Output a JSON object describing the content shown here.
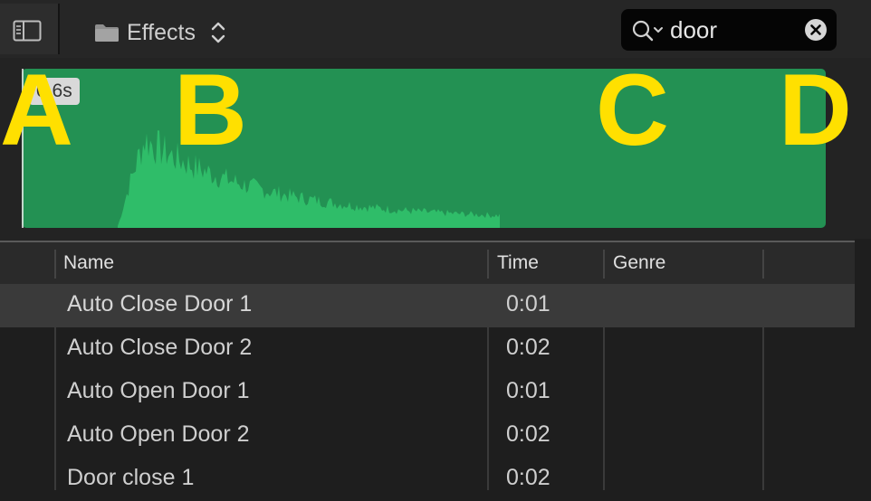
{
  "toolbar": {
    "library_title": "Effects",
    "search_value": "door",
    "icons": {
      "sidebar": "sidebar-toggle-icon",
      "folder": "folder-icon",
      "chevron": "up-down-chevron-icon",
      "search": "search-icon",
      "clear": "clear-icon"
    }
  },
  "preview": {
    "duration_label": "0.6s",
    "wave_color": "#239153",
    "wave_fill": "#2fbd69",
    "markers": [
      "A",
      "B",
      "C",
      "D"
    ]
  },
  "table": {
    "columns": [
      "Name",
      "Time",
      "Genre"
    ],
    "rows": [
      {
        "name": "Auto Close Door 1",
        "time": "0:01",
        "genre": "",
        "selected": true
      },
      {
        "name": "Auto Close Door 2",
        "time": "0:02",
        "genre": ""
      },
      {
        "name": "Auto Open Door 1",
        "time": "0:01",
        "genre": ""
      },
      {
        "name": "Auto Open Door 2",
        "time": "0:02",
        "genre": ""
      },
      {
        "name": "Door close 1",
        "time": "0:02",
        "genre": ""
      }
    ]
  },
  "colors": {
    "marker": "#ffe000",
    "selected_row": "#3a3a3a"
  }
}
